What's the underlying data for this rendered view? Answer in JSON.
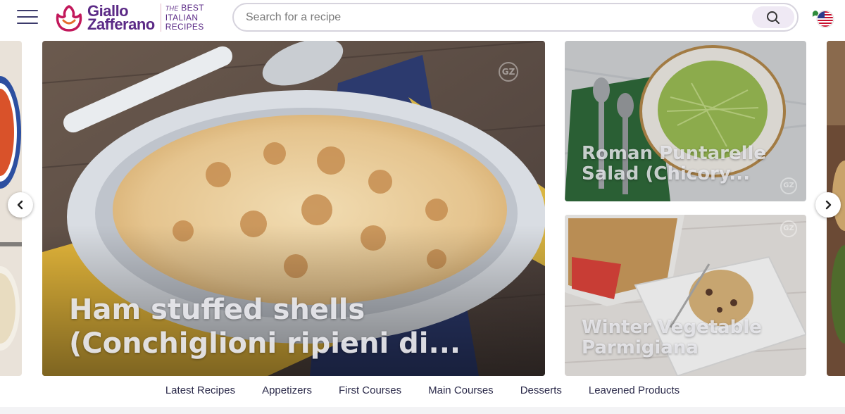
{
  "brand": {
    "logo_line1": "Giallo",
    "logo_line2": "Zafferano",
    "tagline_the": "THE",
    "tagline_best": "BEST",
    "tagline_line2": "ITALIAN",
    "tagline_line3": "RECIPES",
    "primary_color": "#5b2a86",
    "accent_color": "#c2185b"
  },
  "header": {
    "menu_icon": "hamburger-icon",
    "search_placeholder": "Search for a recipe",
    "search_value": "",
    "search_icon": "search-icon",
    "language_icon": "us-flag-icon"
  },
  "carousel": {
    "prev_icon": "chevron-left-icon",
    "next_icon": "chevron-right-icon",
    "featured": {
      "title": "Ham stuffed shells (Conchiglioni ripieni di..."
    },
    "side_cards": [
      {
        "title": "Roman Puntarelle Salad (Chicory..."
      },
      {
        "title": "Winter Vegetable Parmigiana"
      }
    ],
    "watermark": "GZ"
  },
  "categories": [
    "Latest Recipes",
    "Appetizers",
    "First Courses",
    "Main Courses",
    "Desserts",
    "Leavened Products"
  ]
}
